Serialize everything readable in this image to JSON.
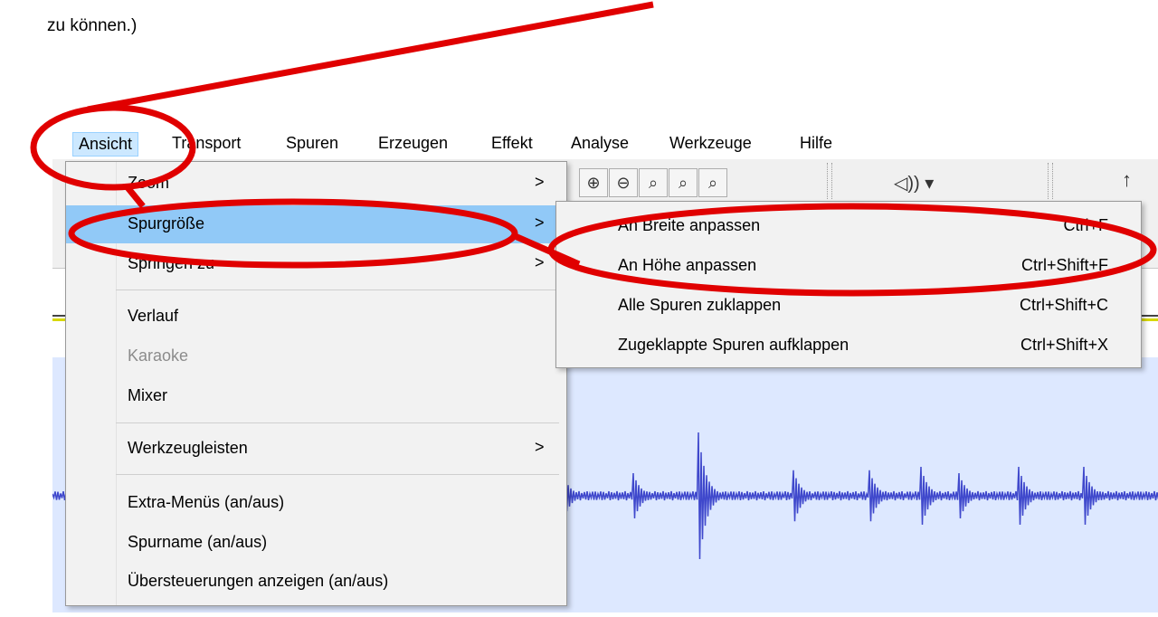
{
  "doc": {
    "line": "zu können.)"
  },
  "menubar": [
    "Ansicht",
    "Transport",
    "Spuren",
    "Erzeugen",
    "Effekt",
    "Analyse",
    "Werkzeuge",
    "Hilfe"
  ],
  "menu": {
    "zoom": "Zoom",
    "spurgroesse": "Spurgröße",
    "springen": "Springen zu",
    "verlauf": "Verlauf",
    "karaoke": "Karaoke",
    "mixer": "Mixer",
    "werkzeugleisten": "Werkzeugleisten",
    "extra": "Extra-Menüs (an/aus)",
    "spurname": "Spurname (an/aus)",
    "uebersteuerung": "Übersteuerungen anzeigen (an/aus)",
    "arrow": ">"
  },
  "submenu": [
    {
      "label": "An Breite anpassen",
      "shortcut": "Ctrl+F"
    },
    {
      "label": "An Höhe anpassen",
      "shortcut": "Ctrl+Shift+F"
    },
    {
      "label": "Alle Spuren zuklappen",
      "shortcut": "Ctrl+Shift+C"
    },
    {
      "label": "Zugeklappte Spuren aufklappen",
      "shortcut": "Ctrl+Shift+X"
    }
  ],
  "colors": {
    "annotation": "#e00000",
    "waveform": "#3f48cc",
    "selection": "#91c9f7"
  },
  "icons": [
    "zoom-in-icon",
    "zoom-out-icon",
    "zoom-sel-icon",
    "zoom-fit-icon",
    "zoom-toggle-icon",
    "speaker-icon"
  ]
}
